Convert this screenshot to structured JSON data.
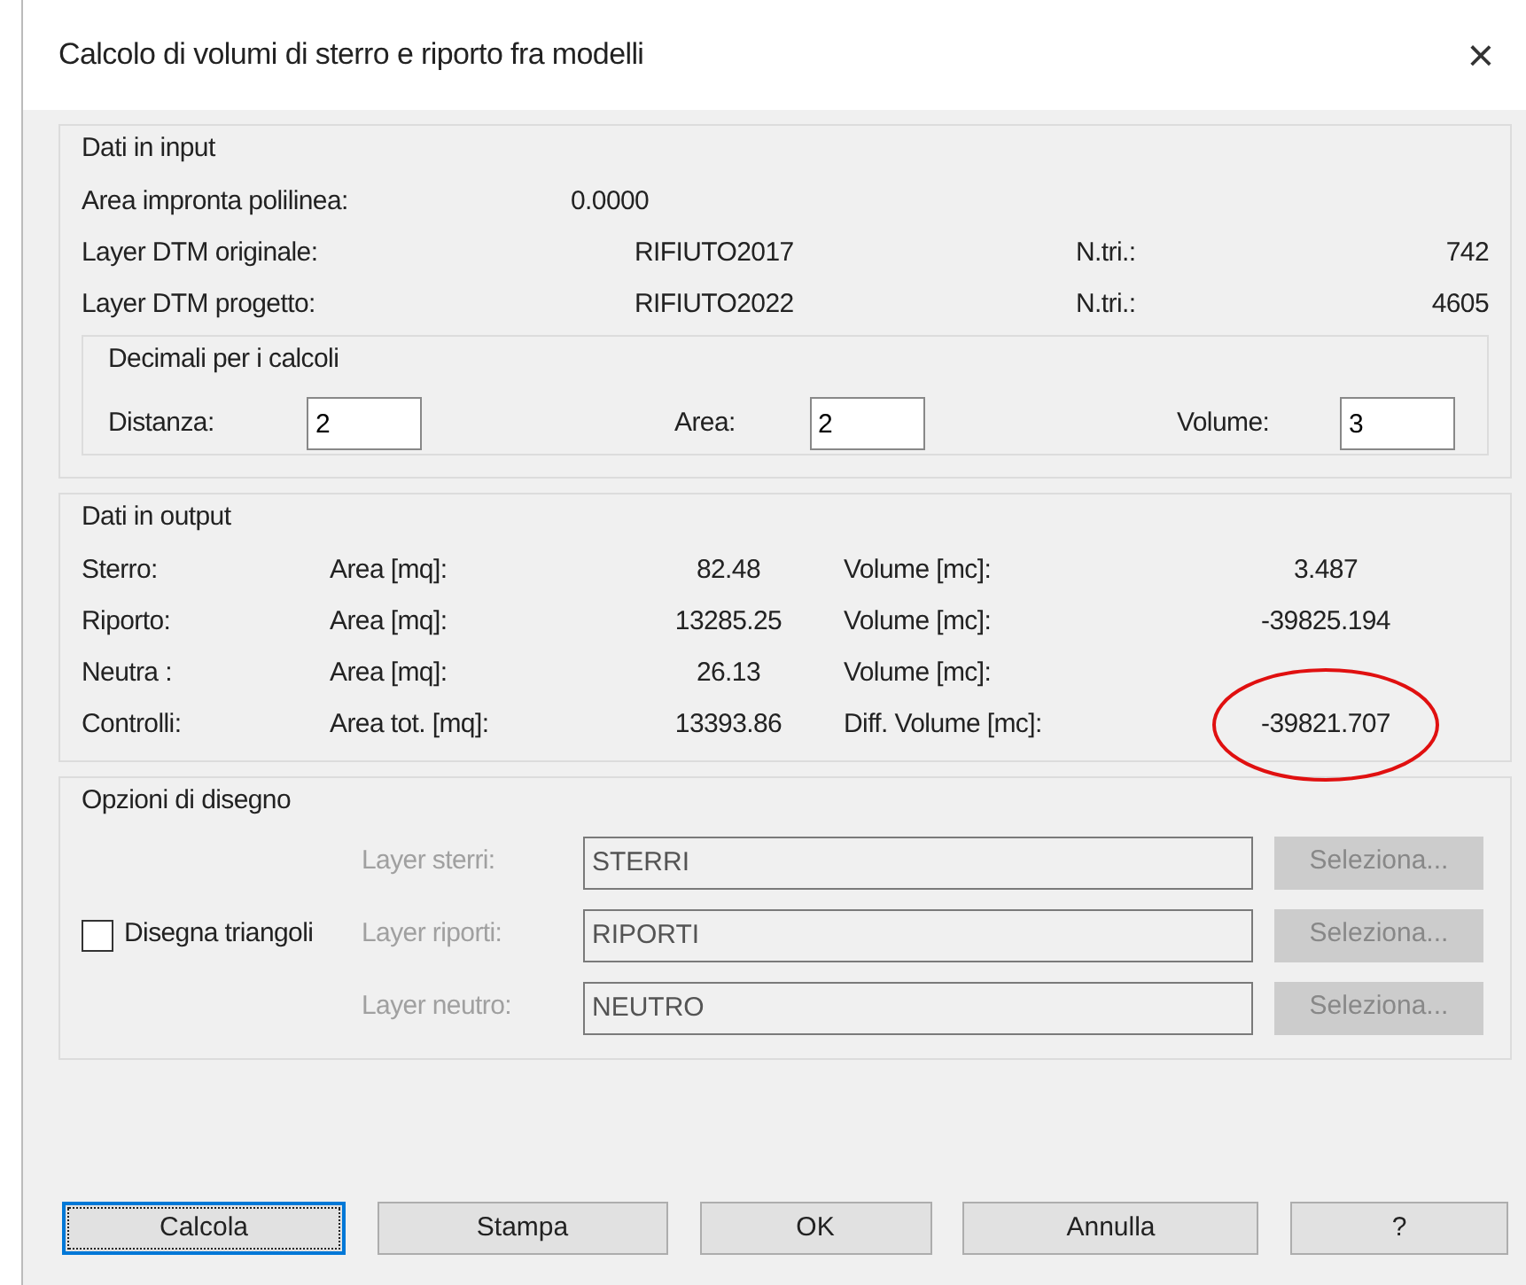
{
  "window": {
    "title": "Calcolo di volumi di sterro e riporto fra modelli",
    "close": "×"
  },
  "input": {
    "title": "Dati in input",
    "rows": [
      {
        "label": "Area impronta polilinea:",
        "value": "0.0000"
      },
      {
        "label": "Layer DTM originale:",
        "value": "RIFIUTO2017",
        "count_label": "N.tri.:",
        "count": "742"
      },
      {
        "label": "Layer DTM progetto:",
        "value": "RIFIUTO2022",
        "count_label": "N.tri.:",
        "count": "4605"
      }
    ],
    "decimals": {
      "title": "Decimali per i calcoli",
      "fields": [
        {
          "label": "Distanza:",
          "value": "2"
        },
        {
          "label": "Area:",
          "value": "2"
        },
        {
          "label": "Volume:",
          "value": "3"
        }
      ]
    }
  },
  "output": {
    "title": "Dati in output",
    "rows": [
      {
        "name": "Sterro:",
        "area_label": "Area [mq]:",
        "area": "82.48",
        "volume_label": "Volume [mc]:",
        "volume": "3.487"
      },
      {
        "name": "Riporto:",
        "area_label": "Area [mq]:",
        "area": "13285.25",
        "volume_label": "Volume [mc]:",
        "volume": "-39825.194"
      },
      {
        "name": "Neutra :",
        "area_label": "Area [mq]:",
        "area": "26.13",
        "volume_label": "Volume [mc]:"
      },
      {
        "name": "Controlli:",
        "area_label": "Area tot. [mq]:",
        "area": "13393.86",
        "volume_label": "Diff. Volume [mc]:",
        "volume": "-39821.707",
        "circled": true
      }
    ]
  },
  "drawing": {
    "title": "Opzioni di disegno",
    "checkbox": {
      "label": "Disegna triangoli",
      "checked": false
    },
    "layers": [
      {
        "label": "Layer sterri:",
        "value": "STERRI",
        "button": "Seleziona...",
        "disabled": true
      },
      {
        "label": "Layer riporti:",
        "value": "RIPORTI",
        "button": "Seleziona...",
        "disabled": true
      },
      {
        "label": "Layer neutro:",
        "value": "NEUTRO",
        "button": "Seleziona...",
        "disabled": true
      }
    ]
  },
  "buttons": [
    {
      "label": "Calcola",
      "default": true
    },
    {
      "label": "Stampa",
      "default": false
    },
    {
      "label": "OK",
      "default": false
    },
    {
      "label": "Annulla",
      "default": false
    },
    {
      "label": "?",
      "default": false
    }
  ]
}
